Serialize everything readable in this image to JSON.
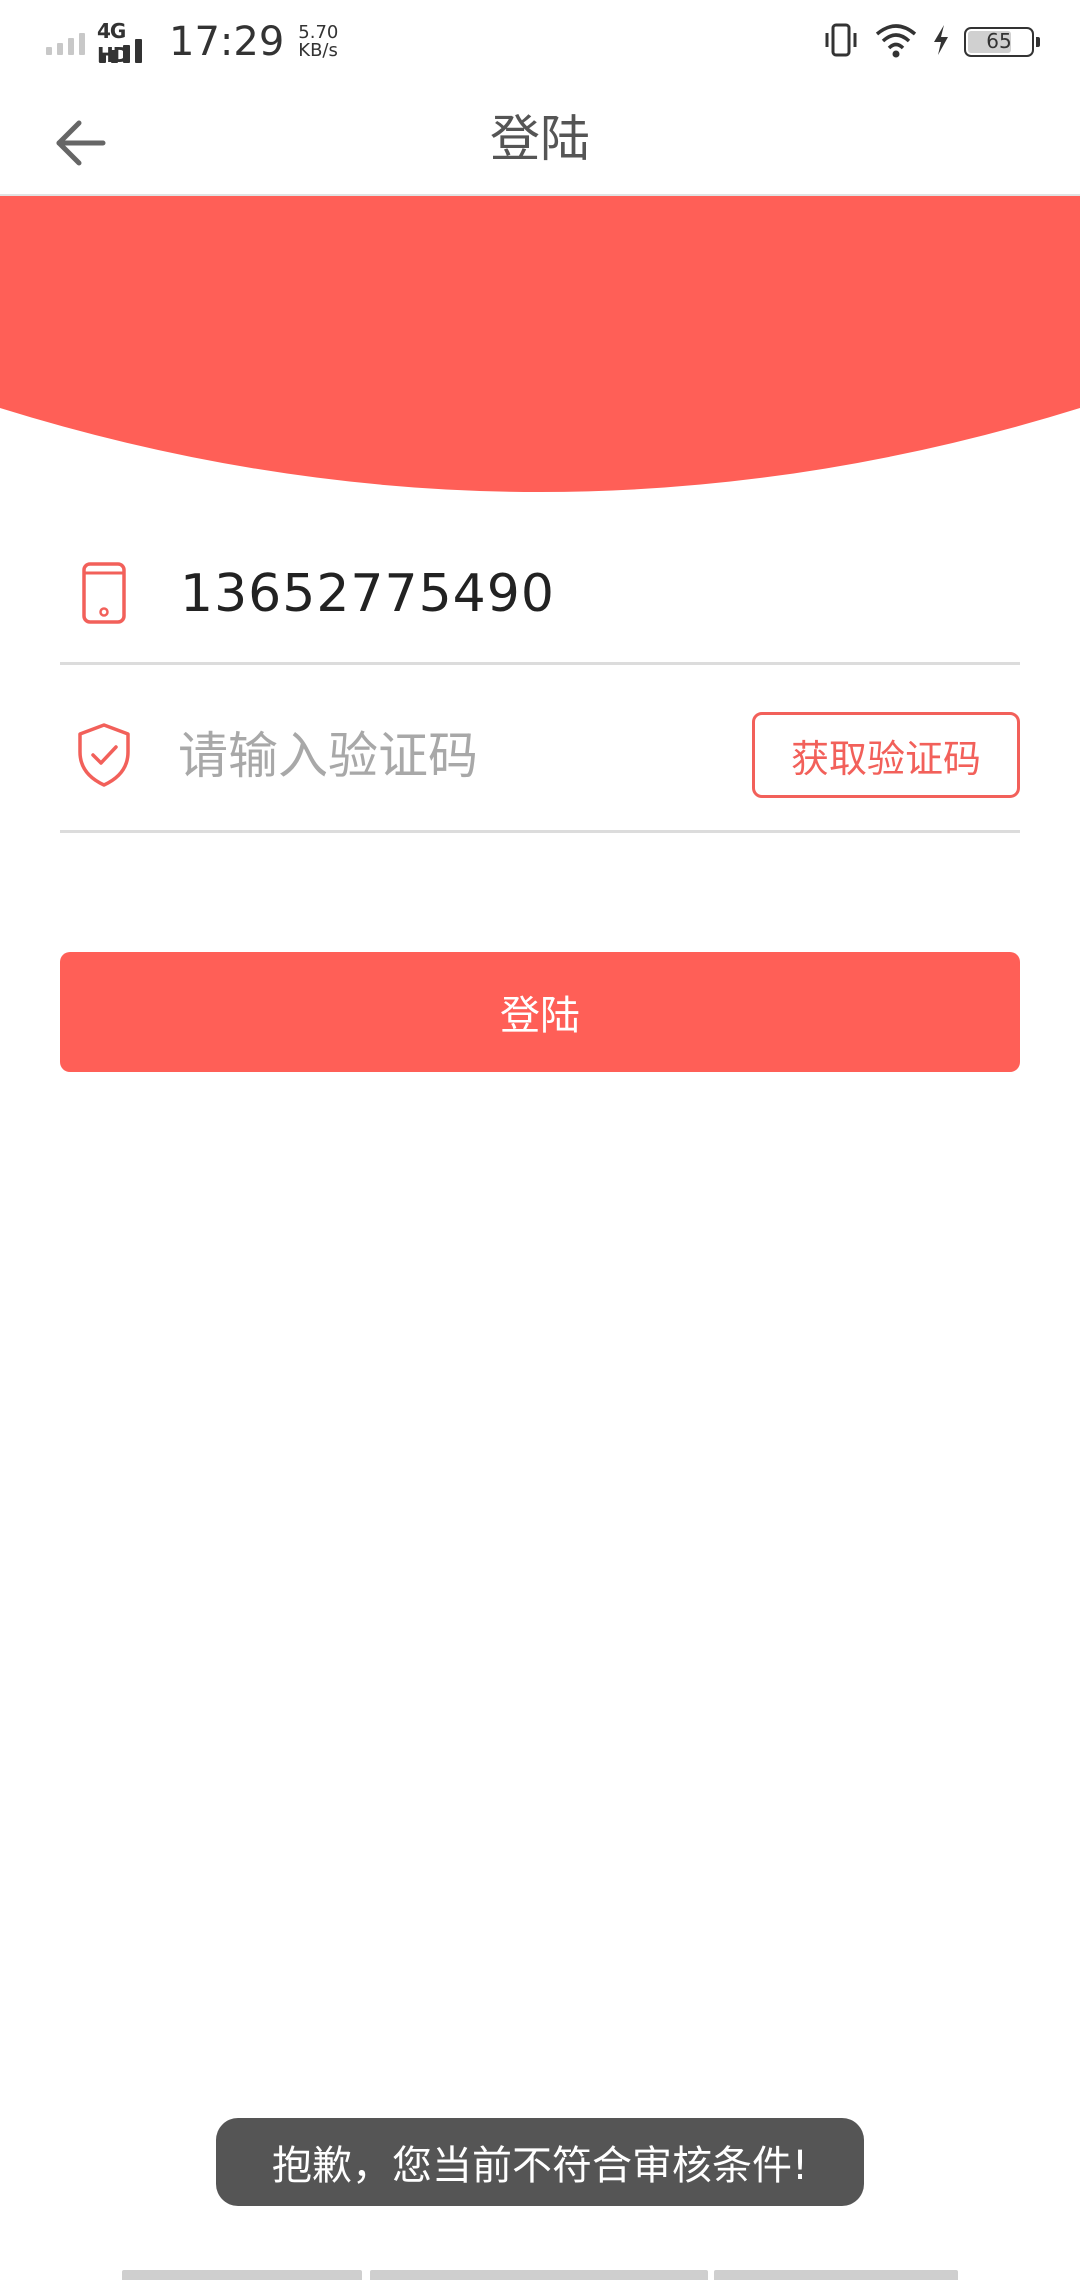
{
  "status_bar": {
    "network_type": "4G HD",
    "time": "17:29",
    "speed_value": "5.70",
    "speed_unit": "KB/s",
    "battery_level": "65"
  },
  "header": {
    "title": "登陆",
    "back_icon": "arrow-left-icon"
  },
  "colors": {
    "accent": "#ff5f57",
    "banner": "#ff5f57",
    "toast_bg": "#555555"
  },
  "form": {
    "phone": {
      "icon": "mobile-phone-icon",
      "value": "13652775490"
    },
    "code": {
      "icon": "shield-check-icon",
      "value": "",
      "placeholder": "请输入验证码",
      "get_code_label": "获取验证码"
    },
    "login_label": "登陆"
  },
  "toast": {
    "message": "抱歉，您当前不符合审核条件!"
  }
}
